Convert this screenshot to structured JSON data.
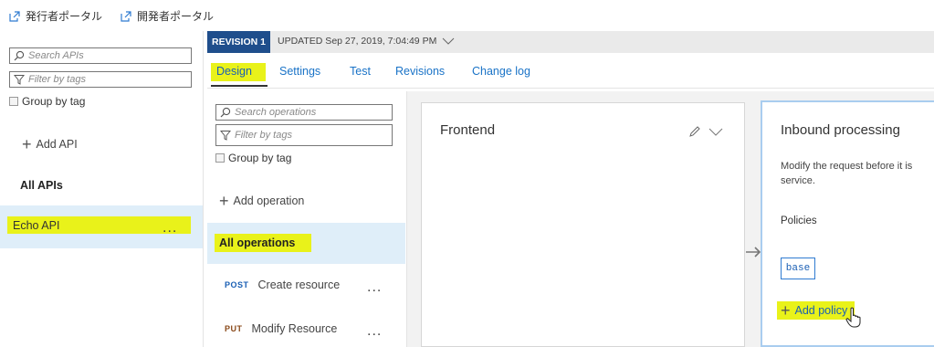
{
  "top_links": {
    "publisher_portal": "発行者ポータル",
    "developer_portal": "開発者ポータル"
  },
  "api_panel": {
    "search_placeholder": "Search APIs",
    "filter_placeholder": "Filter by tags",
    "group_by_tag": "Group by tag",
    "add_api": "Add API",
    "section_title": "All APIs",
    "apis": [
      {
        "name": "Echo API",
        "more": "..."
      }
    ]
  },
  "revision_bar": {
    "badge": "REVISION 1",
    "updated": "UPDATED Sep 27, 2019, 7:04:49 PM"
  },
  "tabs": [
    "Design",
    "Settings",
    "Test",
    "Revisions",
    "Change log"
  ],
  "operations_panel": {
    "search_placeholder": "Search operations",
    "filter_placeholder": "Filter by tags",
    "group_by_tag": "Group by tag",
    "add_operation": "Add operation",
    "all_operations": "All operations",
    "operations": [
      {
        "verb": "POST",
        "name": "Create resource",
        "more": "...",
        "verb_color": "#1a5fb4"
      },
      {
        "verb": "PUT",
        "name": "Modify Resource",
        "more": "...",
        "verb_color": "#8a4a1a"
      }
    ]
  },
  "frontend": {
    "title": "Frontend"
  },
  "inbound": {
    "title": "Inbound processing",
    "description_line1": "Modify the request before it is",
    "description_line2": "service.",
    "policies_label": "Policies",
    "base_tag": "base",
    "add_policy": "Add policy"
  },
  "colors": {
    "highlight": "#e9f21a",
    "revision_badge": "#1f4e8c",
    "link": "#1a73c7",
    "selected_row": "#dfeef9"
  }
}
